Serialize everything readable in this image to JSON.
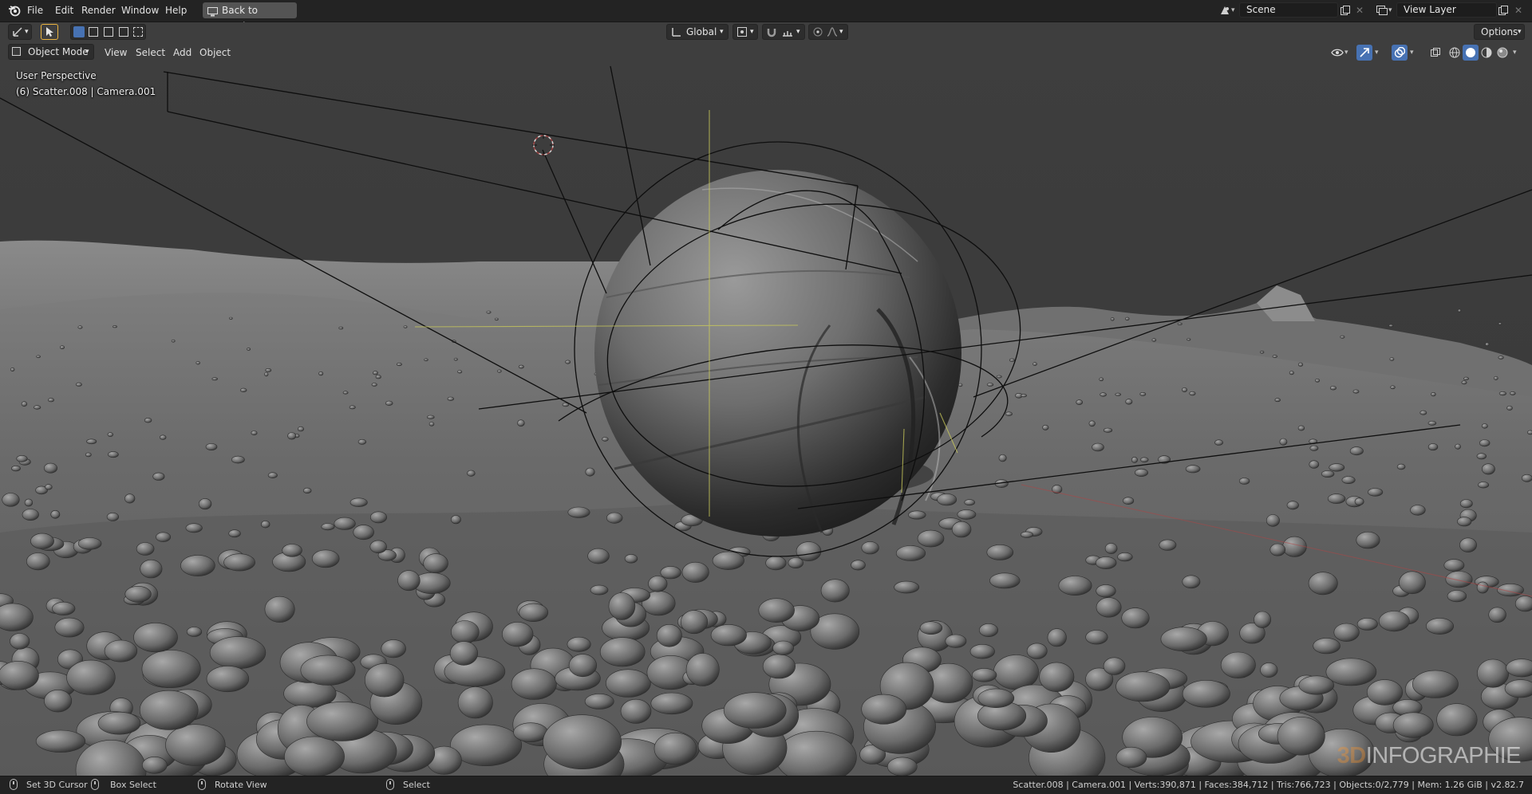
{
  "menubar": {
    "items": [
      "File",
      "Edit",
      "Render",
      "Window",
      "Help"
    ],
    "back_button": "Back to Previous",
    "scene": "Scene",
    "view_layer": "View Layer"
  },
  "tool_header": {
    "orientation": "Global",
    "options": "Options"
  },
  "viewport_header": {
    "mode": "Object Mode",
    "menus": [
      "View",
      "Select",
      "Add",
      "Object"
    ]
  },
  "viewport": {
    "perspective": "User Perspective",
    "active_object": "(6) Scatter.008 | Camera.001",
    "watermark_prefix": "3D",
    "watermark": "INFOGRAPHIE"
  },
  "statusbar": {
    "hints": [
      "Set 3D Cursor",
      "Box Select",
      "Rotate View",
      "Select"
    ],
    "stats": "Scatter.008 | Camera.001 | Verts:390,871 | Faces:384,712 | Tris:766,723 | Objects:0/2,779 | Mem: 1.26 GiB | v2.82.7"
  },
  "colors": {
    "header_bg": "#232323",
    "viewport_bg": "#3d3d3d",
    "accent_blue": "#4772b3",
    "active_tool_outline": "#e9b33f"
  },
  "icons": {
    "app": "blender-logo-icon",
    "back": "monitor-icon",
    "select_tool": "cursor-arrow-icon",
    "snap": "magnet-icon",
    "proportional": "proportional-edit-icon",
    "visibility": "eye-icon",
    "gizmo": "gizmo-icon",
    "overlays": "overlays-icon",
    "xray": "xray-icon",
    "shading": [
      "wireframe-shading-icon",
      "solid-shading-icon",
      "material-shading-icon",
      "rendered-shading-icon"
    ]
  }
}
